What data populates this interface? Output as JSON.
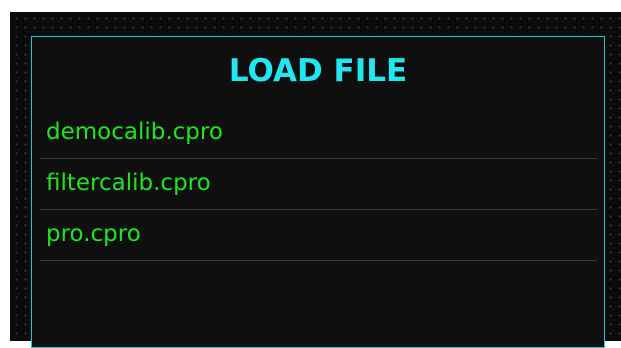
{
  "dialog": {
    "title": "LOAD FILE",
    "files": [
      {
        "name": "democalib.cpro"
      },
      {
        "name": "filtercalib.cpro"
      },
      {
        "name": "pro.cpro"
      }
    ]
  },
  "colors": {
    "title": "#22e6f0",
    "border": "#19c9d3",
    "file_text": "#1ee51e",
    "background": "#0f0f0f",
    "separator": "#3a3a3a"
  }
}
